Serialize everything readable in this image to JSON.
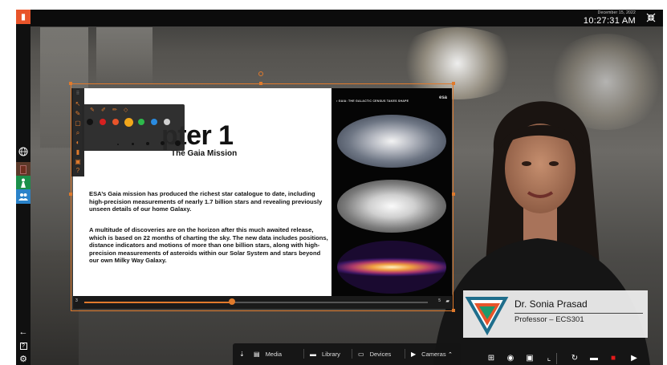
{
  "clock": {
    "date": "December 15, 2022",
    "time": "10:27:31 AM"
  },
  "icons": {
    "app_logo": "presenter-logo-icon",
    "collapse": "collapse-arrows-icon",
    "globe": "globe-icon",
    "whiteboard": "whiteboard-icon",
    "presenter_mode": "person-presenter-icon",
    "participants": "group-icon",
    "arrow_left": "arrow-left-icon",
    "help": "help-icon",
    "settings": "gear-icon"
  },
  "colors": {
    "accent": "#e07a2c",
    "bar": "#0c0c0c",
    "card": "#ebebeb"
  },
  "slide": {
    "title": "pter 1",
    "subtitle": "The Gaia Mission",
    "paragraph1": "ESA’s Gaia mission has produced the richest star catalogue to date, including high-precision measurements of nearly 1.7 billion stars and revealing previously unseen details of our home Galaxy.",
    "paragraph2": "A multitude of discoveries are on the horizon after this much awaited release, which is based on 22 months of charting the sky. The new data includes positions, distance indicators and motions of more than one billion stars, along with high-precision measurements of asteroids within our Solar System and stars beyond our own Milky Way Galaxy.",
    "image_caption": "• GAIA: THE GALACTIC CENSUS TAKES SHAPE",
    "image_logo": "esa",
    "page_current": "3",
    "page_total": "5",
    "progress": 0.43
  },
  "annotation": {
    "colors": [
      "#111111",
      "#d62020",
      "#e8542a",
      "#f2a71b",
      "#2db84b",
      "#2a8be0",
      "#d0d0d0"
    ],
    "selected_color_index": 3
  },
  "presenter": {
    "name": "Dr. Sonia Prasad",
    "role": "Professor – ECS301"
  },
  "tabs": [
    {
      "label": "Media",
      "icon": "media-icon"
    },
    {
      "label": "Library",
      "icon": "folder-icon"
    },
    {
      "label": "Devices",
      "icon": "monitor-icon"
    },
    {
      "label": "Cameras",
      "icon": "camera-icon"
    }
  ],
  "bottom_right_icons": [
    "grid-layout-icon",
    "snapshot-icon",
    "save-icon",
    "crop-icon",
    "refresh-icon",
    "folder-icon",
    "record-icon",
    "video-camera-icon"
  ]
}
